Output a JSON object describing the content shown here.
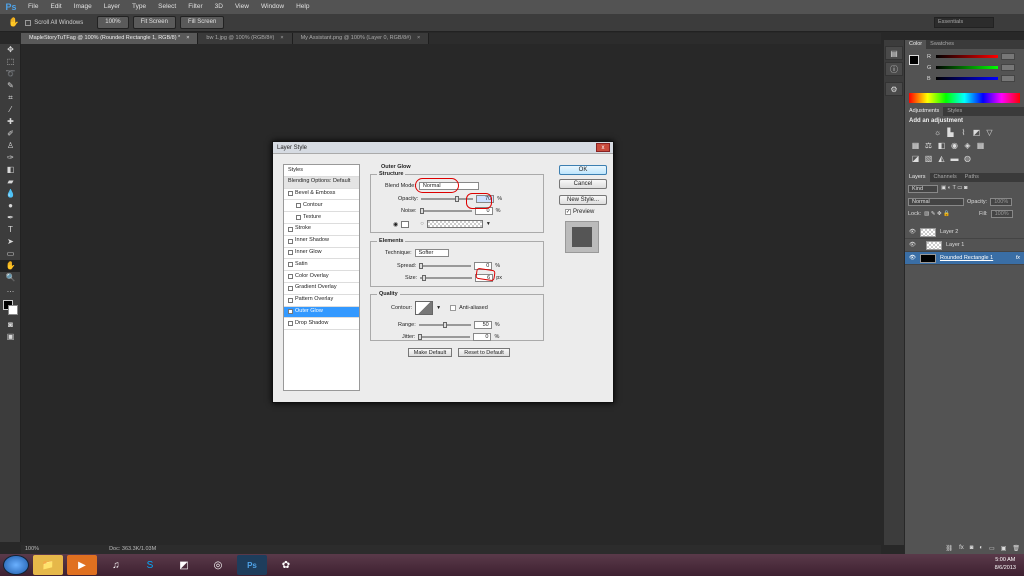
{
  "app": {
    "logo": "Ps"
  },
  "menu": [
    "File",
    "Edit",
    "Image",
    "Layer",
    "Type",
    "Select",
    "Filter",
    "3D",
    "View",
    "Window",
    "Help"
  ],
  "options": {
    "scroll_all": "Scroll All Windows",
    "btn100": "100%",
    "fit": "Fit Screen",
    "fill": "Fill Screen",
    "workspace": "Essentials"
  },
  "tabs": [
    {
      "label": "MapleStoryTuTFag @ 100% (Rounded Rectangle 1, RGB/8) *",
      "close": "×"
    },
    {
      "label": "bw 1.jpg @ 100% (RGB/8#)",
      "close": "×"
    },
    {
      "label": "My Assistant.png @ 100% (Layer 0, RGB/8#)",
      "close": "×"
    }
  ],
  "status": {
    "zoom": "100%",
    "doc": "Doc: 363.3K/1.03M"
  },
  "panels": {
    "color_tabs": [
      "Color",
      "Swatches"
    ],
    "rgb": [
      {
        "l": "R",
        "v": "0"
      },
      {
        "l": "G",
        "v": "0"
      },
      {
        "l": "B",
        "v": "0"
      }
    ],
    "adj_tabs": [
      "Adjustments",
      "Styles"
    ],
    "adj_title": "Add an adjustment",
    "layers_tabs": [
      "Layers",
      "Channels",
      "Paths"
    ],
    "kind": "Kind",
    "blend": "Normal",
    "opacity_label": "Opacity:",
    "opacity_value": "100%",
    "lock_label": "Lock:",
    "fill_label": "Fill:",
    "fill_value": "100%",
    "layers": [
      "Layer 2",
      "Layer 1",
      "Rounded Rectangle 1"
    ],
    "fx": "fx"
  },
  "dialog": {
    "title": "Layer Style",
    "close": "x",
    "styles": [
      "Styles",
      "Blending Options: Default",
      "Bevel & Emboss",
      "Contour",
      "Texture",
      "Stroke",
      "Inner Shadow",
      "Inner Glow",
      "Satin",
      "Color Overlay",
      "Gradient Overlay",
      "Pattern Overlay",
      "Outer Glow",
      "Drop Shadow"
    ],
    "section": "Outer Glow",
    "structure": "Structure",
    "blend_label": "Blend Mode:",
    "blend_value": "Normal",
    "opacity_label": "Opacity:",
    "opacity_value": "70",
    "noise_label": "Noise:",
    "noise_value": "0",
    "pct": "%",
    "elements": "Elements",
    "technique_label": "Technique:",
    "technique_value": "Softer",
    "spread_label": "Spread:",
    "spread_value": "0",
    "size_label": "Size:",
    "size_value": "6",
    "px": "px",
    "quality": "Quality",
    "contour_label": "Contour:",
    "anti_alias": "Anti-aliased",
    "range_label": "Range:",
    "range_value": "50",
    "jitter_label": "Jitter:",
    "jitter_value": "0",
    "make_default": "Make Default",
    "reset_default": "Reset to Default",
    "ok": "OK",
    "cancel": "Cancel",
    "new_style": "New Style...",
    "preview": "Preview"
  },
  "tray": {
    "time": "5:00 AM",
    "date": "8/6/2013"
  }
}
